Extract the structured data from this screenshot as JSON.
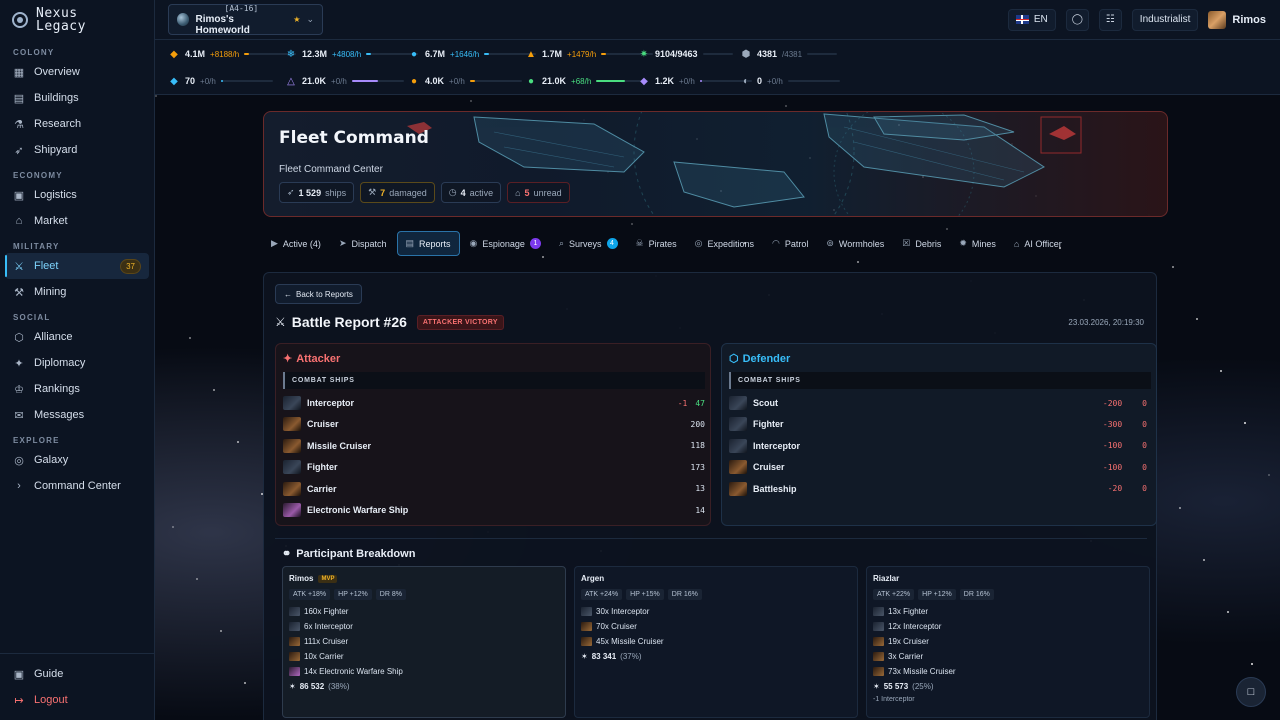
{
  "app": {
    "name_line1": "Nexus",
    "name_line2": "Legacy"
  },
  "sidebar": {
    "sections": [
      {
        "title": "COLONY",
        "items": [
          {
            "label": "Overview",
            "icon": "grid-icon"
          },
          {
            "label": "Buildings",
            "icon": "building-icon"
          },
          {
            "label": "Research",
            "icon": "flask-icon"
          },
          {
            "label": "Shipyard",
            "icon": "rocket-icon"
          }
        ]
      },
      {
        "title": "ECONOMY",
        "items": [
          {
            "label": "Logistics",
            "icon": "truck-icon"
          },
          {
            "label": "Market",
            "icon": "store-icon"
          }
        ]
      },
      {
        "title": "MILITARY",
        "items": [
          {
            "label": "Fleet",
            "icon": "crossed-swords-icon",
            "badge": "37",
            "active": true
          },
          {
            "label": "Mining",
            "icon": "pickaxe-icon"
          }
        ]
      },
      {
        "title": "SOCIAL",
        "items": [
          {
            "label": "Alliance",
            "icon": "shield-icon"
          },
          {
            "label": "Diplomacy",
            "icon": "handshake-icon"
          },
          {
            "label": "Rankings",
            "icon": "trophy-icon"
          },
          {
            "label": "Messages",
            "icon": "mail-icon"
          }
        ]
      },
      {
        "title": "EXPLORE",
        "items": [
          {
            "label": "Galaxy",
            "icon": "globe-icon"
          },
          {
            "label": "Command Center",
            "icon": "terminal-icon"
          }
        ]
      }
    ],
    "guide": "Guide",
    "logout": "Logout"
  },
  "header": {
    "planet_coord": "[A4-16]",
    "planet_name": "Rimos's Homeworld",
    "lang": "EN",
    "role": "Industrialist",
    "username": "Rimos"
  },
  "resources": [
    {
      "value": "4.1M",
      "rate": "+8188/h",
      "color": "#f59e0b",
      "fill": 0.1
    },
    {
      "value": "12.3M",
      "rate": "+4808/h",
      "color": "#38bdf8",
      "fill": 0.1
    },
    {
      "value": "6.7M",
      "rate": "+1646/h",
      "color": "#38bdf8",
      "fill": 0.1
    },
    {
      "value": "1.7M",
      "rate": "+1479/h",
      "color": "#f59e0b",
      "fill": 0.1
    },
    {
      "value": "9104/9463",
      "rate": "",
      "color": "#4ade80",
      "fill": 0
    },
    {
      "value": "4381",
      "rate": "/4381",
      "color": "#9aa8ba",
      "fill": 0
    },
    {
      "value": "70",
      "rate": "+0/h",
      "color": "#38bdf8",
      "fill": 0.05
    },
    {
      "value": "21.0K",
      "rate": "+0/h",
      "color": "#a78bfa",
      "fill": 0.5
    },
    {
      "value": "4.0K",
      "rate": "+0/h",
      "color": "#f59e0b",
      "fill": 0.1
    },
    {
      "value": "21.0K",
      "rate": "+68/h",
      "color": "#4ade80",
      "fill": 0.55
    },
    {
      "value": "1.2K",
      "rate": "+0/h",
      "color": "#a78bfa",
      "fill": 0.05
    },
    {
      "value": "0",
      "rate": "+0/h",
      "color": "#9aa8ba",
      "fill": 0
    }
  ],
  "hero": {
    "title": "Fleet Command",
    "subtitle": "Fleet Command Center",
    "chips": [
      {
        "value": "1 529",
        "label": "ships",
        "kind": ""
      },
      {
        "value": "7",
        "label": "damaged",
        "kind": "warn"
      },
      {
        "value": "4",
        "label": "active",
        "kind": ""
      },
      {
        "value": "5",
        "label": "unread",
        "kind": "red"
      }
    ]
  },
  "tabs": [
    {
      "label": "Active (4)",
      "icon": "play-icon"
    },
    {
      "label": "Dispatch",
      "icon": "send-icon"
    },
    {
      "label": "Reports",
      "icon": "file-icon",
      "active": true
    },
    {
      "label": "Espionage",
      "icon": "eye-icon",
      "badge": "1",
      "badge_color": "#7c3aed"
    },
    {
      "label": "Surveys",
      "icon": "search-icon",
      "badge": "4",
      "badge_color": "#0ea5e9"
    },
    {
      "label": "Pirates",
      "icon": "skull-icon"
    },
    {
      "label": "Expeditions",
      "icon": "compass-icon"
    },
    {
      "label": "Patrol",
      "icon": "radar-icon"
    },
    {
      "label": "Wormholes",
      "icon": "vortex-icon"
    },
    {
      "label": "Debris",
      "icon": "trash-icon"
    },
    {
      "label": "Mines",
      "icon": "mine-icon"
    },
    {
      "label": "AI Officer",
      "icon": "robot-icon"
    }
  ],
  "report": {
    "back": "Back to Reports",
    "title": "Battle Report #26",
    "result": "ATTACKER VICTORY",
    "date": "23.03.2026, 20:19:30",
    "attacker": {
      "title": "Attacker",
      "section": "COMBAT SHIPS",
      "ships": [
        {
          "name": "Interceptor",
          "loss": "-1",
          "count": "47",
          "thumb": "grey"
        },
        {
          "name": "Cruiser",
          "count": "200",
          "thumb": "orange"
        },
        {
          "name": "Missile Cruiser",
          "count": "118",
          "thumb": "orange"
        },
        {
          "name": "Fighter",
          "count": "173",
          "thumb": "grey"
        },
        {
          "name": "Carrier",
          "count": "13",
          "thumb": "orange"
        },
        {
          "name": "Electronic Warfare Ship",
          "count": "14",
          "thumb": "purple"
        }
      ]
    },
    "defender": {
      "title": "Defender",
      "section": "COMBAT SHIPS",
      "ships": [
        {
          "name": "Scout",
          "loss": "-200",
          "count": "0",
          "thumb": "grey"
        },
        {
          "name": "Fighter",
          "loss": "-300",
          "count": "0",
          "thumb": "grey"
        },
        {
          "name": "Interceptor",
          "loss": "-100",
          "count": "0",
          "thumb": "grey"
        },
        {
          "name": "Cruiser",
          "loss": "-100",
          "count": "0",
          "thumb": "orange"
        },
        {
          "name": "Battleship",
          "loss": "-20",
          "count": "0",
          "thumb": "orange"
        }
      ]
    },
    "participants_title": "Participant Breakdown",
    "participants": [
      {
        "name": "Rimos",
        "mvp": "MVP",
        "stats": [
          "ATK +18%",
          "HP +12%",
          "DR 8%"
        ],
        "ships": [
          [
            "160x Fighter",
            "g"
          ],
          [
            "6x Interceptor",
            "g"
          ],
          [
            "111x Cruiser",
            "o"
          ],
          [
            "10x Carrier",
            "o"
          ],
          [
            "14x Electronic Warfare Ship",
            "p"
          ]
        ],
        "damage": "86 532",
        "pct": "(38%)",
        "lost": ""
      },
      {
        "name": "Argen",
        "mvp": "",
        "stats": [
          "ATK +24%",
          "HP +15%",
          "DR 16%"
        ],
        "ships": [
          [
            "30x Interceptor",
            "g"
          ],
          [
            "70x Cruiser",
            "o"
          ],
          [
            "45x Missile Cruiser",
            "o"
          ]
        ],
        "damage": "83 341",
        "pct": "(37%)",
        "lost": ""
      },
      {
        "name": "Riazlar",
        "mvp": "",
        "stats": [
          "ATK +22%",
          "HP +12%",
          "DR 16%"
        ],
        "ships": [
          [
            "13x Fighter",
            "g"
          ],
          [
            "12x Interceptor",
            "g"
          ],
          [
            "19x Cruiser",
            "o"
          ],
          [
            "3x Carrier",
            "o"
          ],
          [
            "73x Missile Cruiser",
            "o"
          ]
        ],
        "damage": "55 573",
        "pct": "(25%)",
        "lost": "-1 Interceptor"
      }
    ]
  }
}
